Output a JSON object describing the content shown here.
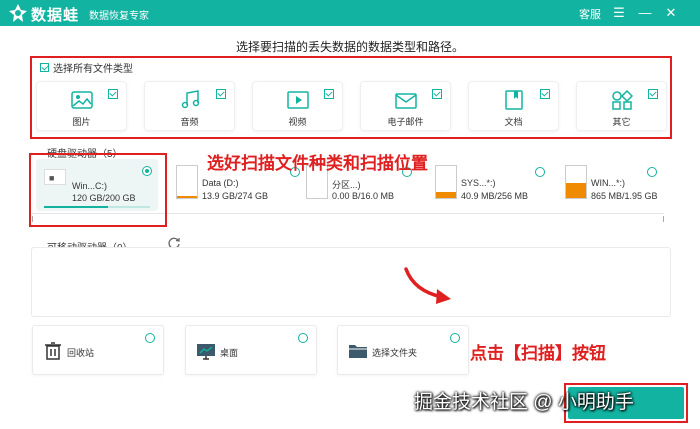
{
  "titlebar": {
    "app_name": "数据蛙",
    "app_subtitle": "数据恢复专家",
    "support_link": "客服",
    "buttons": [
      "menu-icon",
      "minimize-icon",
      "close-icon"
    ],
    "bg_color": "#13b3a1"
  },
  "prompt": "选择要扫描的丢失数据的数据类型和路径。",
  "file_types": {
    "select_all_label": "选择所有文件类型",
    "select_all_checked": true,
    "items": [
      {
        "label": "图片",
        "icon": "image-icon",
        "checked": true
      },
      {
        "label": "音频",
        "icon": "music-icon",
        "checked": true
      },
      {
        "label": "视频",
        "icon": "video-icon",
        "checked": true
      },
      {
        "label": "电子邮件",
        "icon": "email-icon",
        "checked": true
      },
      {
        "label": "文档",
        "icon": "document-icon",
        "checked": true
      },
      {
        "label": "其它",
        "icon": "other-icon",
        "checked": true
      }
    ]
  },
  "hard_drives": {
    "label": "硬盘驱动器（5）",
    "items": [
      {
        "name": "Win...C:)",
        "size": "120 GB/200 GB",
        "selected": true,
        "fill": 0.6
      },
      {
        "name": "Data (D:)",
        "size": "13.9 GB/274 GB",
        "selected": false,
        "fill": 0.05
      },
      {
        "name": "分区...)",
        "size": "0.00  B/16.0 MB",
        "selected": false,
        "fill": 0.0
      },
      {
        "name": "SYS...*:)",
        "size": "40.9 MB/256 MB",
        "selected": false,
        "fill": 0.16
      },
      {
        "name": "WIN...*:)",
        "size": "865 MB/1.95 GB",
        "selected": false,
        "fill": 0.44
      }
    ]
  },
  "removable_drives": {
    "label": "可移动驱动器（0）",
    "refresh_icon": "refresh-icon"
  },
  "locations": [
    {
      "label": "回收站",
      "icon": "recycle-bin-icon"
    },
    {
      "label": "桌面",
      "icon": "desktop-icon"
    },
    {
      "label": "选择文件夹",
      "icon": "folder-icon"
    }
  ],
  "annotations": {
    "choose_text": "选好扫描文件种类和扫描位置",
    "click_text": "点击【扫描】按钮",
    "color": "#e02020"
  },
  "watermark": "掘金技术社区 @ 小明助手"
}
